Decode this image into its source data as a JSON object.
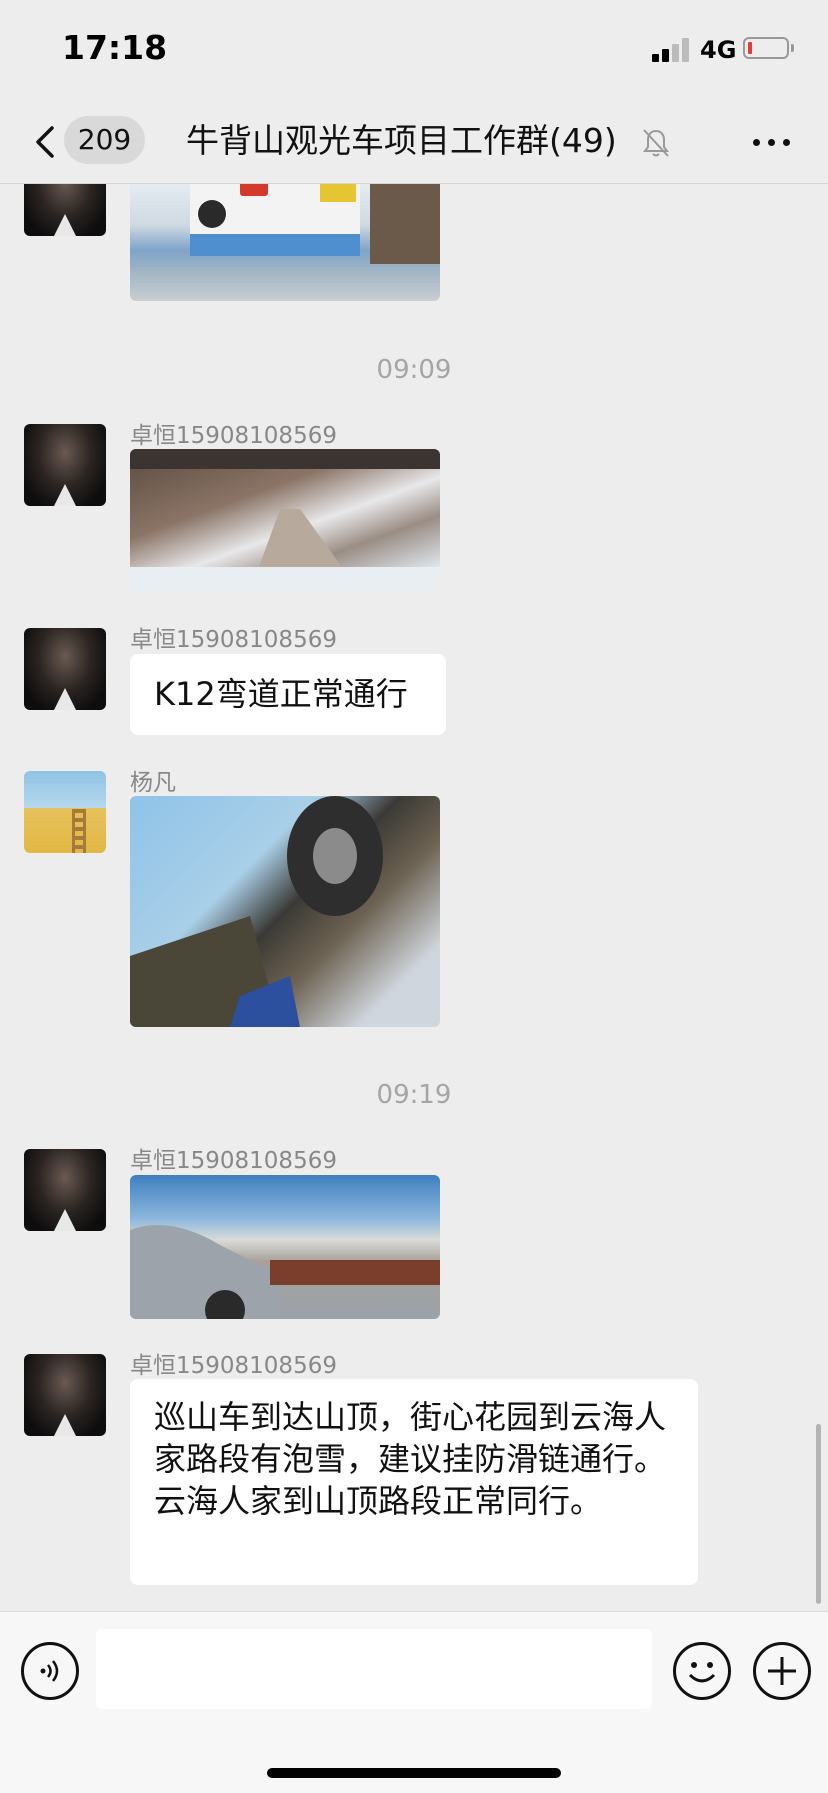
{
  "status_bar": {
    "time": "17:18",
    "network": "4G"
  },
  "nav": {
    "unread_count": "209",
    "title": "牛背山观光车项目工作群(49)",
    "icons": [
      "chevron-left-icon",
      "bell-muted-icon",
      "more-icon"
    ]
  },
  "messages": {
    "timestamps": [
      "09:09",
      "09:19"
    ],
    "items": [
      {
        "sender": "",
        "type": "image",
        "description_icon": "bus-photo"
      },
      {
        "sender": "卓恒15908108569",
        "type": "image"
      },
      {
        "sender": "卓恒15908108569",
        "type": "text",
        "text": "K12弯道正常通行"
      },
      {
        "sender": "杨凡",
        "type": "image"
      },
      {
        "sender": "卓恒15908108569",
        "type": "image"
      },
      {
        "sender": "卓恒15908108569",
        "type": "text",
        "text": "巡山车到达山顶，街心花园到云海人家路段有泡雪，建议挂防滑链通行。云海人家到山顶路段正常同行。"
      }
    ]
  },
  "input_bar": {
    "text_value": "",
    "icons": [
      "voice-icon",
      "emoji-icon",
      "plus-icon"
    ]
  },
  "colors": {
    "background": "#ededed",
    "bubble": "#ffffff",
    "battery_low": "#e23b3b",
    "timestamp": "#a5a5a5"
  }
}
